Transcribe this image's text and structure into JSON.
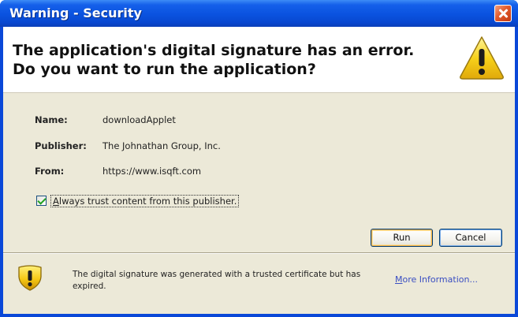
{
  "window": {
    "title": "Warning - Security"
  },
  "header": {
    "message": "The application's digital signature has an error.  Do you want to run the application?"
  },
  "details": {
    "fields": [
      {
        "label": "Name:",
        "value": "downloadApplet"
      },
      {
        "label": "Publisher:",
        "value": "The Johnathan Group, Inc."
      },
      {
        "label": "From:",
        "value": "https://www.isqft.com"
      }
    ]
  },
  "trust": {
    "checked": true,
    "accel": "A",
    "rest": "lways trust content from this publisher."
  },
  "buttons": {
    "run": "Run",
    "cancel": "Cancel"
  },
  "footer": {
    "message": "The digital signature was generated with a trusted certificate but has expired.",
    "link_accel": "M",
    "link_rest": "ore Information..."
  },
  "icons": {
    "close": "close-icon",
    "warning": "warning-triangle-icon",
    "shield": "warning-shield-icon",
    "checkmark": "checkmark-icon"
  },
  "colors": {
    "titlebar": "#0a52df",
    "panel": "#ece9d8",
    "link": "#3a4ec2",
    "warning_yellow": "#f7d21b"
  }
}
